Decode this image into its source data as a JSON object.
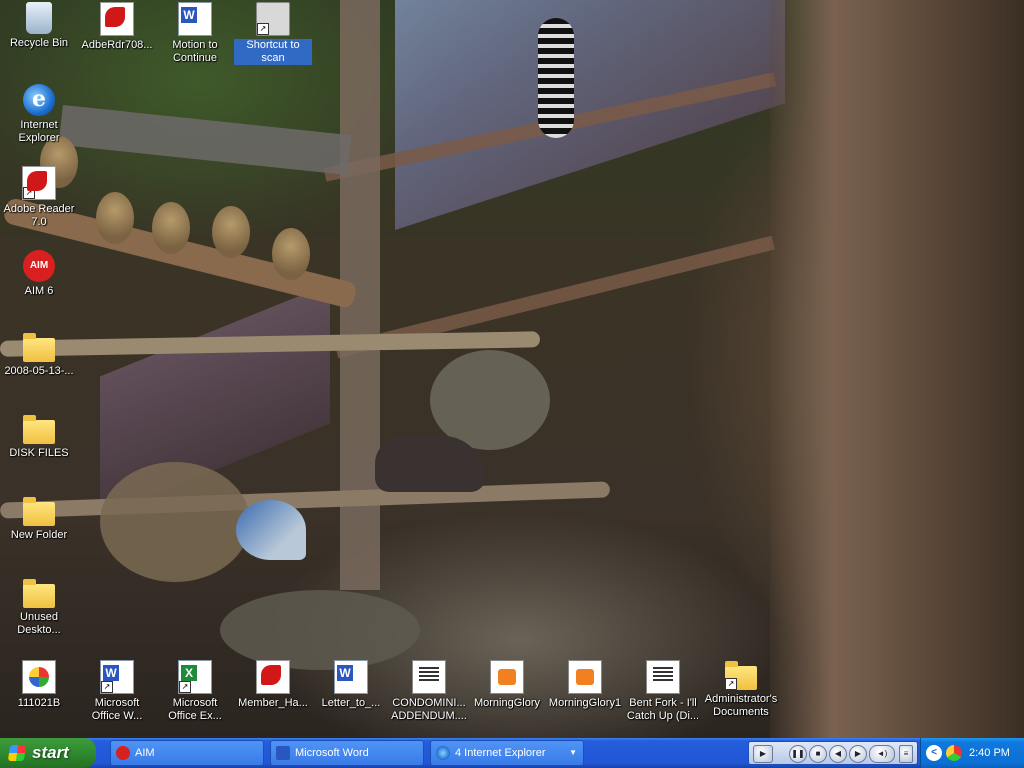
{
  "desktop": {
    "icons": [
      {
        "label": "Recycle Bin",
        "icon": "recycle-bin-icon",
        "shortcut": false,
        "selected": false
      },
      {
        "label": "AdbeRdr708...",
        "icon": "pdf-installer-icon",
        "shortcut": false,
        "selected": false
      },
      {
        "label": "Motion to Continue",
        "icon": "word-document-icon",
        "shortcut": false,
        "selected": false
      },
      {
        "label": "Shortcut to scan",
        "icon": "scanner-icon",
        "shortcut": true,
        "selected": true
      },
      {
        "label": "Internet Explorer",
        "icon": "internet-explorer-icon",
        "shortcut": false,
        "selected": false
      },
      {
        "label": "Adobe Reader 7.0",
        "icon": "adobe-reader-icon",
        "shortcut": true,
        "selected": false
      },
      {
        "label": "AIM 6",
        "icon": "aim-icon",
        "shortcut": false,
        "selected": false
      },
      {
        "label": "2008-05-13-...",
        "icon": "folder-icon",
        "shortcut": false,
        "selected": false
      },
      {
        "label": "DISK FILES",
        "icon": "folder-icon",
        "shortcut": false,
        "selected": false
      },
      {
        "label": "New Folder",
        "icon": "folder-icon",
        "shortcut": false,
        "selected": false
      },
      {
        "label": "Unused Deskto...",
        "icon": "folder-icon",
        "shortcut": false,
        "selected": false
      },
      {
        "label": "111021B",
        "icon": "image-file-icon",
        "shortcut": false,
        "selected": false
      },
      {
        "label": "Microsoft Office W...",
        "icon": "word-icon",
        "shortcut": true,
        "selected": false
      },
      {
        "label": "Microsoft Office Ex...",
        "icon": "excel-icon",
        "shortcut": true,
        "selected": false
      },
      {
        "label": "Member_Ha...",
        "icon": "pdf-file-icon",
        "shortcut": false,
        "selected": false
      },
      {
        "label": "Letter_to_...",
        "icon": "word-document-icon",
        "shortcut": false,
        "selected": false
      },
      {
        "label": "CONDOMINI... ADDENDUM....",
        "icon": "document-icon",
        "shortcut": false,
        "selected": false
      },
      {
        "label": "MorningGlory",
        "icon": "orange-file-icon",
        "shortcut": false,
        "selected": false
      },
      {
        "label": "MorningGlory1",
        "icon": "orange-file-icon",
        "shortcut": false,
        "selected": false
      },
      {
        "label": "Bent Fork - I'll Catch Up (Di...",
        "icon": "document-icon",
        "shortcut": false,
        "selected": false
      },
      {
        "label": "Administrator's Documents",
        "icon": "folder-icon",
        "shortcut": true,
        "selected": false
      }
    ]
  },
  "taskbar": {
    "start_label": "start",
    "tasks": [
      {
        "label": "AIM",
        "icon": "aim-icon"
      },
      {
        "label": "Microsoft Word",
        "icon": "word-icon"
      },
      {
        "label": "4 Internet Explorer",
        "icon": "internet-explorer-icon",
        "dropdown": true
      }
    ],
    "media_controls": [
      "pause",
      "stop",
      "previous",
      "next",
      "volume",
      "menu"
    ],
    "clock": "2:40 PM",
    "colors": {
      "taskbar": "#245edb",
      "start": "#2f8a2f",
      "tray": "#0c6fd4",
      "selection": "#316ac5"
    }
  }
}
